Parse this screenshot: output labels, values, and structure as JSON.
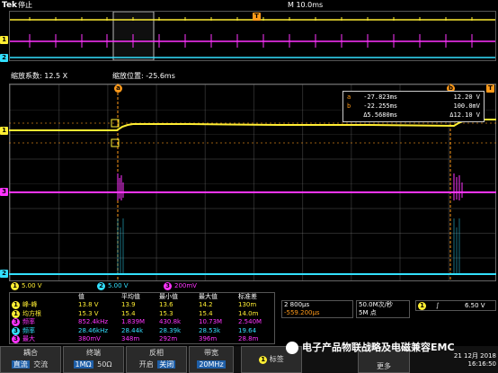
{
  "header": {
    "brand": "Tek",
    "run_state": "停止",
    "timebase": "M 10.0ms"
  },
  "zoom": {
    "factor_label": "缩放系数: 12.5 X",
    "position_label": "缩放位置:  -25.6ms"
  },
  "channel_markers": {
    "ch1": "1",
    "ch2": "2",
    "ch3": "3",
    "trigger": "T",
    "cursor_a": "a",
    "cursor_b": "b"
  },
  "cursor_readout": {
    "row1": {
      "icon": "a",
      "time": "-27.823ms",
      "value": "12.20 V"
    },
    "row2": {
      "icon": "b",
      "time": "-22.255ms",
      "value": "100.0mV"
    },
    "row3": {
      "time": "Δ5.5680ms",
      "value": "Δ12.10 V"
    }
  },
  "scales": {
    "ch1": "5.00 V",
    "ch2": "5.00 V",
    "ch3": "200mV"
  },
  "measurements": {
    "headers": [
      "值",
      "平均值",
      "最小值",
      "最大值",
      "标准差"
    ],
    "rows": [
      {
        "ch": "1",
        "name": "峰-峰",
        "color": "#ffee33",
        "values": [
          "13.8 V",
          "13.9",
          "13.6",
          "14.2",
          "130m"
        ]
      },
      {
        "ch": "1",
        "name": "均方根",
        "color": "#ffee33",
        "values": [
          "15.3 V",
          "15.4",
          "15.3",
          "15.4",
          "14.0m"
        ]
      },
      {
        "ch": "3",
        "name": "频率",
        "color": "#ff33ff",
        "values": [
          "852.4kHz",
          "1.839M",
          "430.8k",
          "10.73M",
          "2.540M"
        ]
      },
      {
        "ch": "3",
        "name": "频率",
        "color": "#33e0ff",
        "values": [
          "28.46kHz",
          "28.44k",
          "28.39k",
          "28.53k",
          "19.64"
        ]
      },
      {
        "ch": "3",
        "name": "最大",
        "color": "#ff33ff",
        "values": [
          "380mV",
          "348m",
          "292m",
          "396m",
          "28.8m"
        ]
      }
    ]
  },
  "acquisition": {
    "horizontal": "2 800μs",
    "position": "-559.200μs",
    "sample_rate": "50.0M次/秒",
    "record_length": "5M 点",
    "trigger_channel": "1",
    "trigger_level": "6.50 V"
  },
  "bottom_menu": {
    "coupling": {
      "title": "耦合",
      "options": [
        "直流",
        "交流"
      ],
      "selected": "直流"
    },
    "termination": {
      "title": "终端",
      "options": [
        "1MΩ",
        "50Ω"
      ],
      "selected": "1MΩ"
    },
    "invert": {
      "title": "反相",
      "options": [
        "开启",
        "关闭"
      ],
      "selected": "关闭"
    },
    "bandwidth": {
      "title": "带宽",
      "value": "20MHz"
    },
    "label": {
      "ch": "1",
      "text": "标签"
    },
    "more": "更多"
  },
  "watermark": "电子产品物联战略及电磁兼容EMC",
  "datetime": {
    "date": "21 12月 2018",
    "time": "16:16:50"
  },
  "colors": {
    "ch1": "#ffee33",
    "ch2": "#33e0ff",
    "ch3": "#ff33ff",
    "cursor": "#ff9a1a",
    "selected_button": "#1f5fa8"
  }
}
